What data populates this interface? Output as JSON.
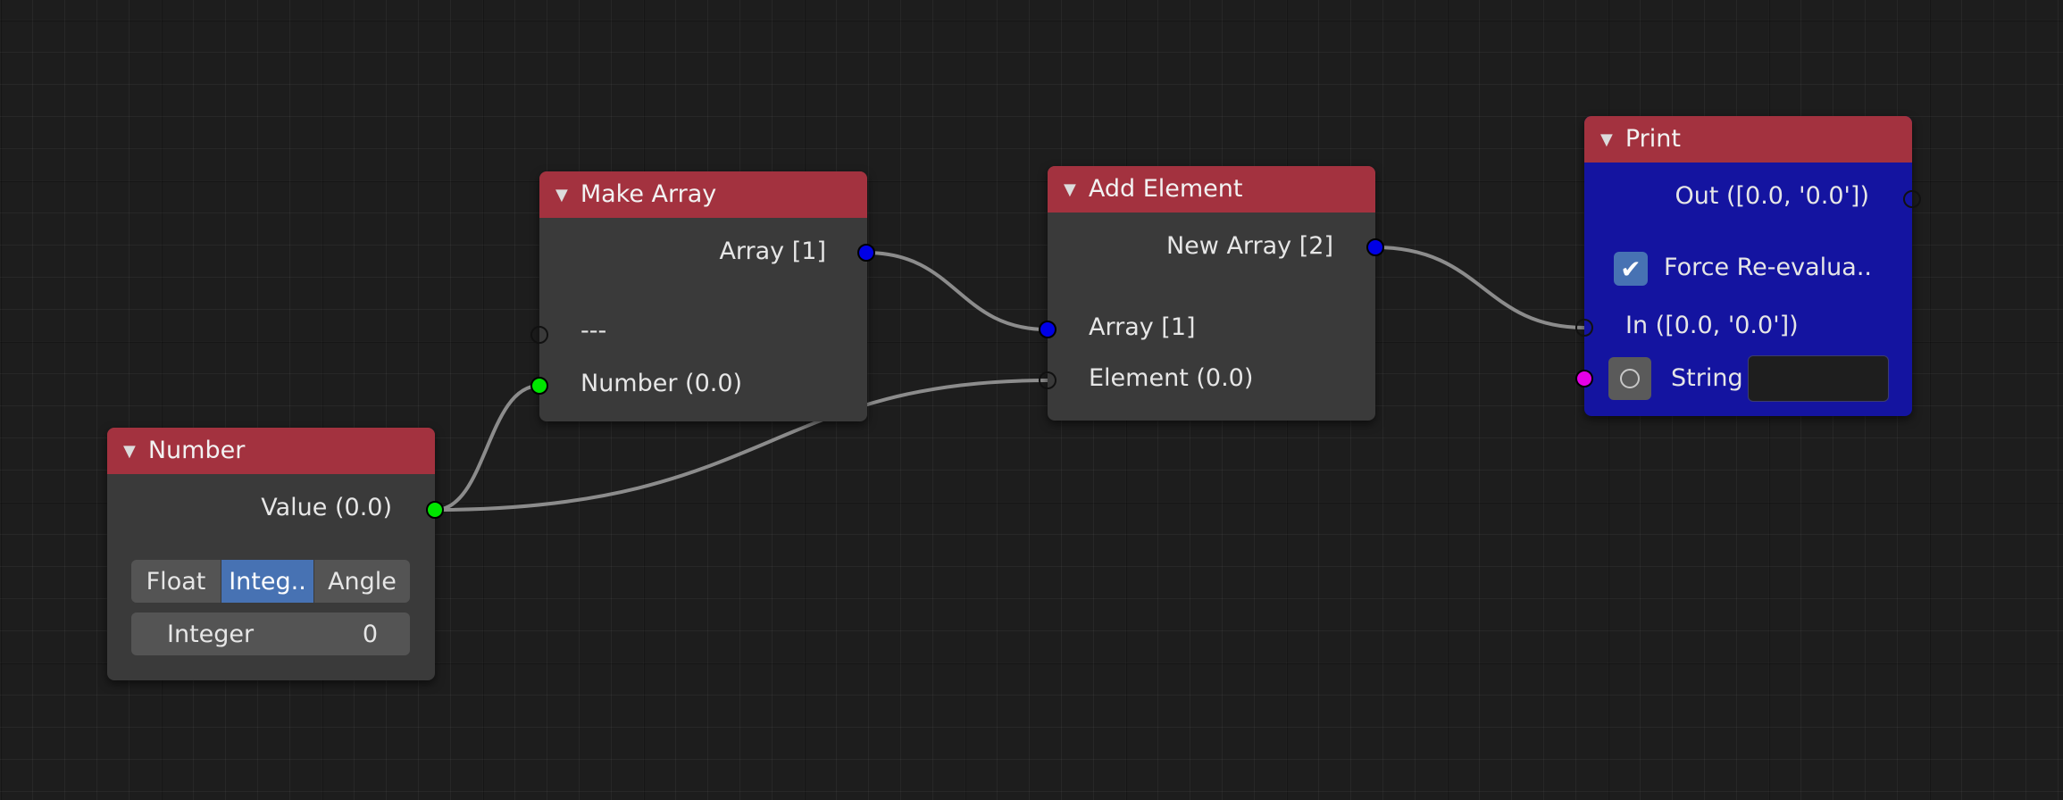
{
  "colors": {
    "header": "#a3323f",
    "node_body": "#3a3a3a",
    "print_body": "#1414a0",
    "socket_float": "#00e600",
    "socket_array": "#0000e6",
    "socket_string": "#e600e6",
    "accent": "#4772b3",
    "link": "#8c8c8c"
  },
  "nodes": {
    "number": {
      "title": "Number",
      "output_label": "Value (0.0)",
      "modes": [
        "Float",
        "Integ..",
        "Angle"
      ],
      "active_mode": "Integ..",
      "field_label": "Integer",
      "field_value": "0"
    },
    "make_array": {
      "title": "Make Array",
      "output_label": "Array [1]",
      "placeholder_label": "---",
      "input_label": "Number (0.0)"
    },
    "add_element": {
      "title": "Add Element",
      "output_label": "New Array [2]",
      "input_array_label": "Array [1]",
      "input_element_label": "Element (0.0)"
    },
    "print": {
      "title": "Print",
      "output_label": "Out ([0.0, '0.0'])",
      "checkbox_label": "Force Re-evalua..",
      "checkbox_checked": true,
      "input_label": "In ([0.0, '0.0'])",
      "string_label": "String",
      "string_value": ""
    }
  },
  "icons": {
    "collapse": "triangle-down-icon",
    "check": "check-icon",
    "toggle": "circle-icon"
  }
}
